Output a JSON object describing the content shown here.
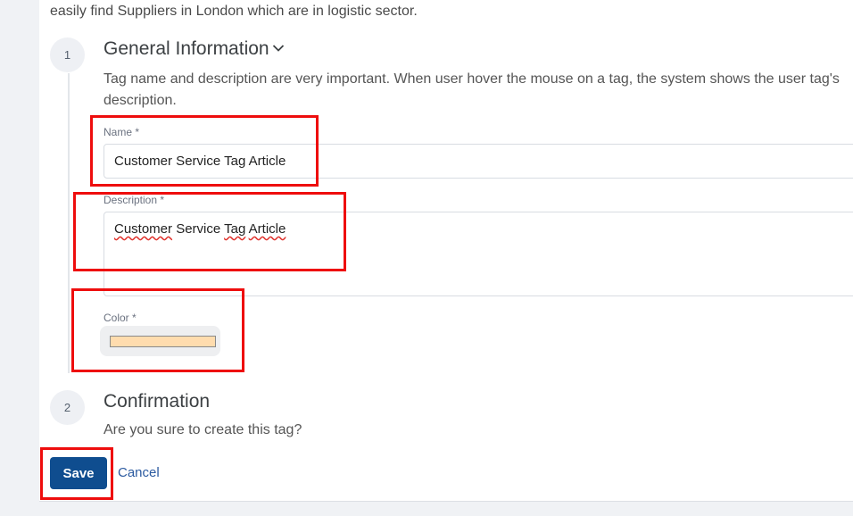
{
  "intro": {
    "text": "easily find Suppliers in London which are in logistic sector."
  },
  "steps": [
    {
      "number": "1",
      "title": "General Information",
      "description": "Tag name and description are very important. When user hover the mouse on a tag, the system shows the user tag's description.",
      "icon": "chevron-down-icon"
    },
    {
      "number": "2",
      "title": "Confirmation",
      "description": "Are you sure to create this tag?"
    }
  ],
  "form": {
    "name": {
      "label": "Name *",
      "value": "Customer Service Tag Article"
    },
    "description": {
      "label": "Description *",
      "value_words": [
        "Customer",
        " Service ",
        "Tag",
        " ",
        "Article"
      ]
    },
    "color": {
      "label": "Color *",
      "value": "#ffdcae"
    }
  },
  "actions": {
    "save_label": "Save",
    "cancel_label": "Cancel"
  },
  "colors": {
    "primary": "#0f4d8f",
    "highlight": "#ee0d0d",
    "link": "#2b5aa0"
  }
}
